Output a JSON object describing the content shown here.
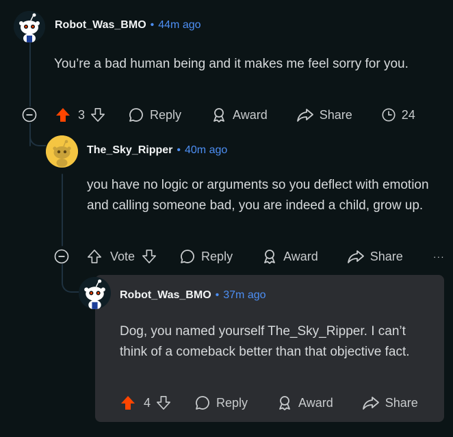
{
  "comments": [
    {
      "username": "Robot_Was_BMO",
      "time": "44m ago",
      "body": "You’re a bad human being and it makes me feel sorry for you.",
      "score": "3",
      "reply_label": "Reply",
      "award_label": "Award",
      "share_label": "Share",
      "extra_count": "24",
      "upvoted": true
    },
    {
      "username": "The_Sky_Ripper",
      "time": "40m ago",
      "body": "you have no logic or arguments so you deflect with emotion and calling someone bad, you are indeed a child, grow up.",
      "score": "Vote",
      "reply_label": "Reply",
      "award_label": "Award",
      "share_label": "Share",
      "more_label": "···",
      "upvoted": false
    },
    {
      "username": "Robot_Was_BMO",
      "time": "37m ago",
      "body": "Dog, you named yourself The_Sky_Ripper. I can’t think of a comeback better than that objective fact.",
      "score": "4",
      "reply_label": "Reply",
      "award_label": "Award",
      "share_label": "Share",
      "upvoted": true
    }
  ],
  "separator": "•",
  "colors": {
    "background": "#0b1416",
    "link": "#4d8ff4",
    "upvote": "#ff4500",
    "panel": "#2b2d31"
  }
}
